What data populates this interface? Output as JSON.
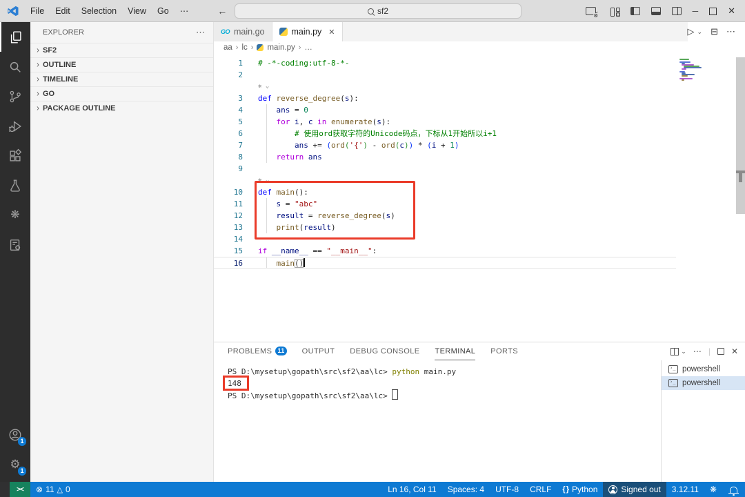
{
  "colors": {
    "accent": "#0e7ad3",
    "annotation": "#ea3b29",
    "remote_green": "#16825d",
    "statusbar_blue": "#0e7ad3",
    "activitybar": "#2d2d2d"
  },
  "icons": {
    "ellipsis": "⋯",
    "chevron_down": "⌄",
    "back": "←",
    "forward": "→",
    "minimize": "─",
    "close": "✕",
    "breadcrumb_sep": "›",
    "section_chevron": "›",
    "error": "⊗",
    "warning": "△",
    "remote": "><",
    "run": "▷",
    "split_editor": "⊟",
    "deco": "❋",
    "swirl": "❋"
  },
  "titlebar": {
    "menu": [
      "File",
      "Edit",
      "Selection",
      "View",
      "Go"
    ],
    "menu_more": "⋯",
    "search_value": "sf2"
  },
  "activity_bar": {
    "items": [
      {
        "name": "explorer",
        "active": true
      },
      {
        "name": "search"
      },
      {
        "name": "source-control"
      },
      {
        "name": "run-and-debug"
      },
      {
        "name": "extensions"
      },
      {
        "name": "testing"
      },
      {
        "name": "extension-swirl"
      },
      {
        "name": "extension-file-gear"
      }
    ],
    "bottom": [
      {
        "name": "accounts",
        "badge": "1"
      },
      {
        "name": "settings",
        "badge": "1"
      }
    ]
  },
  "sidebar": {
    "title": "EXPLORER",
    "sections": [
      "SF2",
      "OUTLINE",
      "TIMELINE",
      "GO",
      "PACKAGE OUTLINE"
    ]
  },
  "tabs": [
    {
      "label": "main.go",
      "icon": "go"
    },
    {
      "label": "main.py",
      "icon": "python",
      "active": true,
      "close": true
    }
  ],
  "breadcrumb": [
    {
      "label": "aa"
    },
    {
      "label": "lc"
    },
    {
      "label": "main.py",
      "icon": "python"
    },
    {
      "label": "…"
    }
  ],
  "editor": {
    "lines": [
      {
        "num": 1,
        "tokens": [
          [
            "com",
            "# -*-coding:utf-8-*-"
          ]
        ]
      },
      {
        "num": 2,
        "tokens": []
      },
      {
        "deco": true
      },
      {
        "num": 3,
        "tokens": [
          [
            "kw",
            "def"
          ],
          [
            "pl",
            " "
          ],
          [
            "fn",
            "reverse_degree"
          ],
          [
            "pl",
            "("
          ],
          [
            "vr",
            "s"
          ],
          [
            "pl",
            "):"
          ]
        ]
      },
      {
        "num": 4,
        "guide": true,
        "tokens": [
          [
            "pl",
            "    "
          ],
          [
            "vr",
            "ans"
          ],
          [
            "pl",
            " = "
          ],
          [
            "cn",
            "0"
          ]
        ]
      },
      {
        "num": 5,
        "guide": true,
        "tokens": [
          [
            "pl",
            "    "
          ],
          [
            "ctl",
            "for"
          ],
          [
            "pl",
            " "
          ],
          [
            "vr",
            "i"
          ],
          [
            "pl",
            ", "
          ],
          [
            "vr",
            "c"
          ],
          [
            "pl",
            " "
          ],
          [
            "ctl",
            "in"
          ],
          [
            "pl",
            " "
          ],
          [
            "fn",
            "enumerate"
          ],
          [
            "pl",
            "("
          ],
          [
            "vr",
            "s"
          ],
          [
            "pl",
            "):"
          ]
        ]
      },
      {
        "num": 6,
        "guide": true,
        "tokens": [
          [
            "pl",
            "        "
          ],
          [
            "com",
            "# 使用ord获取字符的Unicode码点，下标从1开始所以i+1"
          ]
        ]
      },
      {
        "num": 7,
        "guide": true,
        "tokens": [
          [
            "pl",
            "        "
          ],
          [
            "vr",
            "ans"
          ],
          [
            "pl",
            " += "
          ],
          [
            "b1",
            "("
          ],
          [
            "fn",
            "ord"
          ],
          [
            "b2",
            "("
          ],
          [
            "st",
            "'{'"
          ],
          [
            "b2",
            ")"
          ],
          [
            "pl",
            " - "
          ],
          [
            "fn",
            "ord"
          ],
          [
            "b2",
            "("
          ],
          [
            "vr",
            "c"
          ],
          [
            "b2",
            ")"
          ],
          [
            "b1",
            ")"
          ],
          [
            "pl",
            " * "
          ],
          [
            "b1",
            "("
          ],
          [
            "vr",
            "i"
          ],
          [
            "pl",
            " + "
          ],
          [
            "cn",
            "1"
          ],
          [
            "b1",
            ")"
          ]
        ]
      },
      {
        "num": 8,
        "guide": true,
        "tokens": [
          [
            "pl",
            "    "
          ],
          [
            "ctl",
            "return"
          ],
          [
            "pl",
            " "
          ],
          [
            "vr",
            "ans"
          ]
        ]
      },
      {
        "num": 9,
        "tokens": []
      },
      {
        "deco": true
      },
      {
        "num": 10,
        "tokens": [
          [
            "kw",
            "def"
          ],
          [
            "pl",
            " "
          ],
          [
            "fn",
            "main"
          ],
          [
            "pl",
            "():"
          ]
        ]
      },
      {
        "num": 11,
        "guide": true,
        "tokens": [
          [
            "pl",
            "    "
          ],
          [
            "vr",
            "s"
          ],
          [
            "pl",
            " = "
          ],
          [
            "st",
            "\"abc\""
          ]
        ]
      },
      {
        "num": 12,
        "guide": true,
        "tokens": [
          [
            "pl",
            "    "
          ],
          [
            "vr",
            "result"
          ],
          [
            "pl",
            " = "
          ],
          [
            "fn",
            "reverse_degree"
          ],
          [
            "pl",
            "("
          ],
          [
            "vr",
            "s"
          ],
          [
            "pl",
            ")"
          ]
        ]
      },
      {
        "num": 13,
        "guide": true,
        "tokens": [
          [
            "pl",
            "    "
          ],
          [
            "fn",
            "print"
          ],
          [
            "pl",
            "("
          ],
          [
            "vr",
            "result"
          ],
          [
            "pl",
            ")"
          ]
        ]
      },
      {
        "num": 14,
        "tokens": []
      },
      {
        "num": 15,
        "tokens": [
          [
            "ctl",
            "if"
          ],
          [
            "pl",
            " "
          ],
          [
            "vr",
            "__name__"
          ],
          [
            "pl",
            " == "
          ],
          [
            "st",
            "\"__main__\""
          ],
          [
            "pl",
            ":"
          ]
        ]
      },
      {
        "num": 16,
        "guide": true,
        "current": true,
        "tokens": [
          [
            "pl",
            "    "
          ],
          [
            "fn",
            "main"
          ],
          [
            "match",
            "()"
          ],
          [
            "cursor",
            ""
          ]
        ]
      }
    ]
  },
  "panel": {
    "tabs": [
      {
        "label": "PROBLEMS",
        "badge": "11"
      },
      {
        "label": "OUTPUT"
      },
      {
        "label": "DEBUG CONSOLE"
      },
      {
        "label": "TERMINAL",
        "active": true
      },
      {
        "label": "PORTS"
      }
    ],
    "terminal": {
      "rows": [
        {
          "tokens": [
            [
              "tp",
              "PS D:\\mysetup\\gopath\\src\\sf2\\aa\\lc> "
            ],
            [
              "tc",
              "python"
            ],
            [
              "tp",
              " main.py"
            ]
          ]
        },
        {
          "tokens": [
            [
              "tp",
              "148"
            ]
          ],
          "annotated": true
        },
        {
          "tokens": [
            [
              "tp",
              "PS D:\\mysetup\\gopath\\src\\sf2\\aa\\lc> "
            ]
          ],
          "cursor": true
        }
      ],
      "list": [
        {
          "label": "powershell"
        },
        {
          "label": "powershell",
          "selected": true
        }
      ]
    }
  },
  "status_bar": {
    "problems": {
      "errors": "11",
      "warnings": "0"
    },
    "right_items": [
      {
        "name": "cursor-position",
        "label": "Ln 16, Col 11"
      },
      {
        "name": "indentation",
        "label": "Spaces: 4"
      },
      {
        "name": "encoding",
        "label": "UTF-8"
      },
      {
        "name": "eol",
        "label": "CRLF"
      },
      {
        "name": "language-mode",
        "label": "Python",
        "icon": "braces"
      },
      {
        "name": "accounts-signed-out",
        "label": "Signed out",
        "icon": "account",
        "dark": true
      },
      {
        "name": "python-version",
        "label": "3.12.11"
      },
      {
        "name": "extension-status",
        "icon": "swirl"
      },
      {
        "name": "notifications",
        "icon": "bell"
      }
    ]
  }
}
